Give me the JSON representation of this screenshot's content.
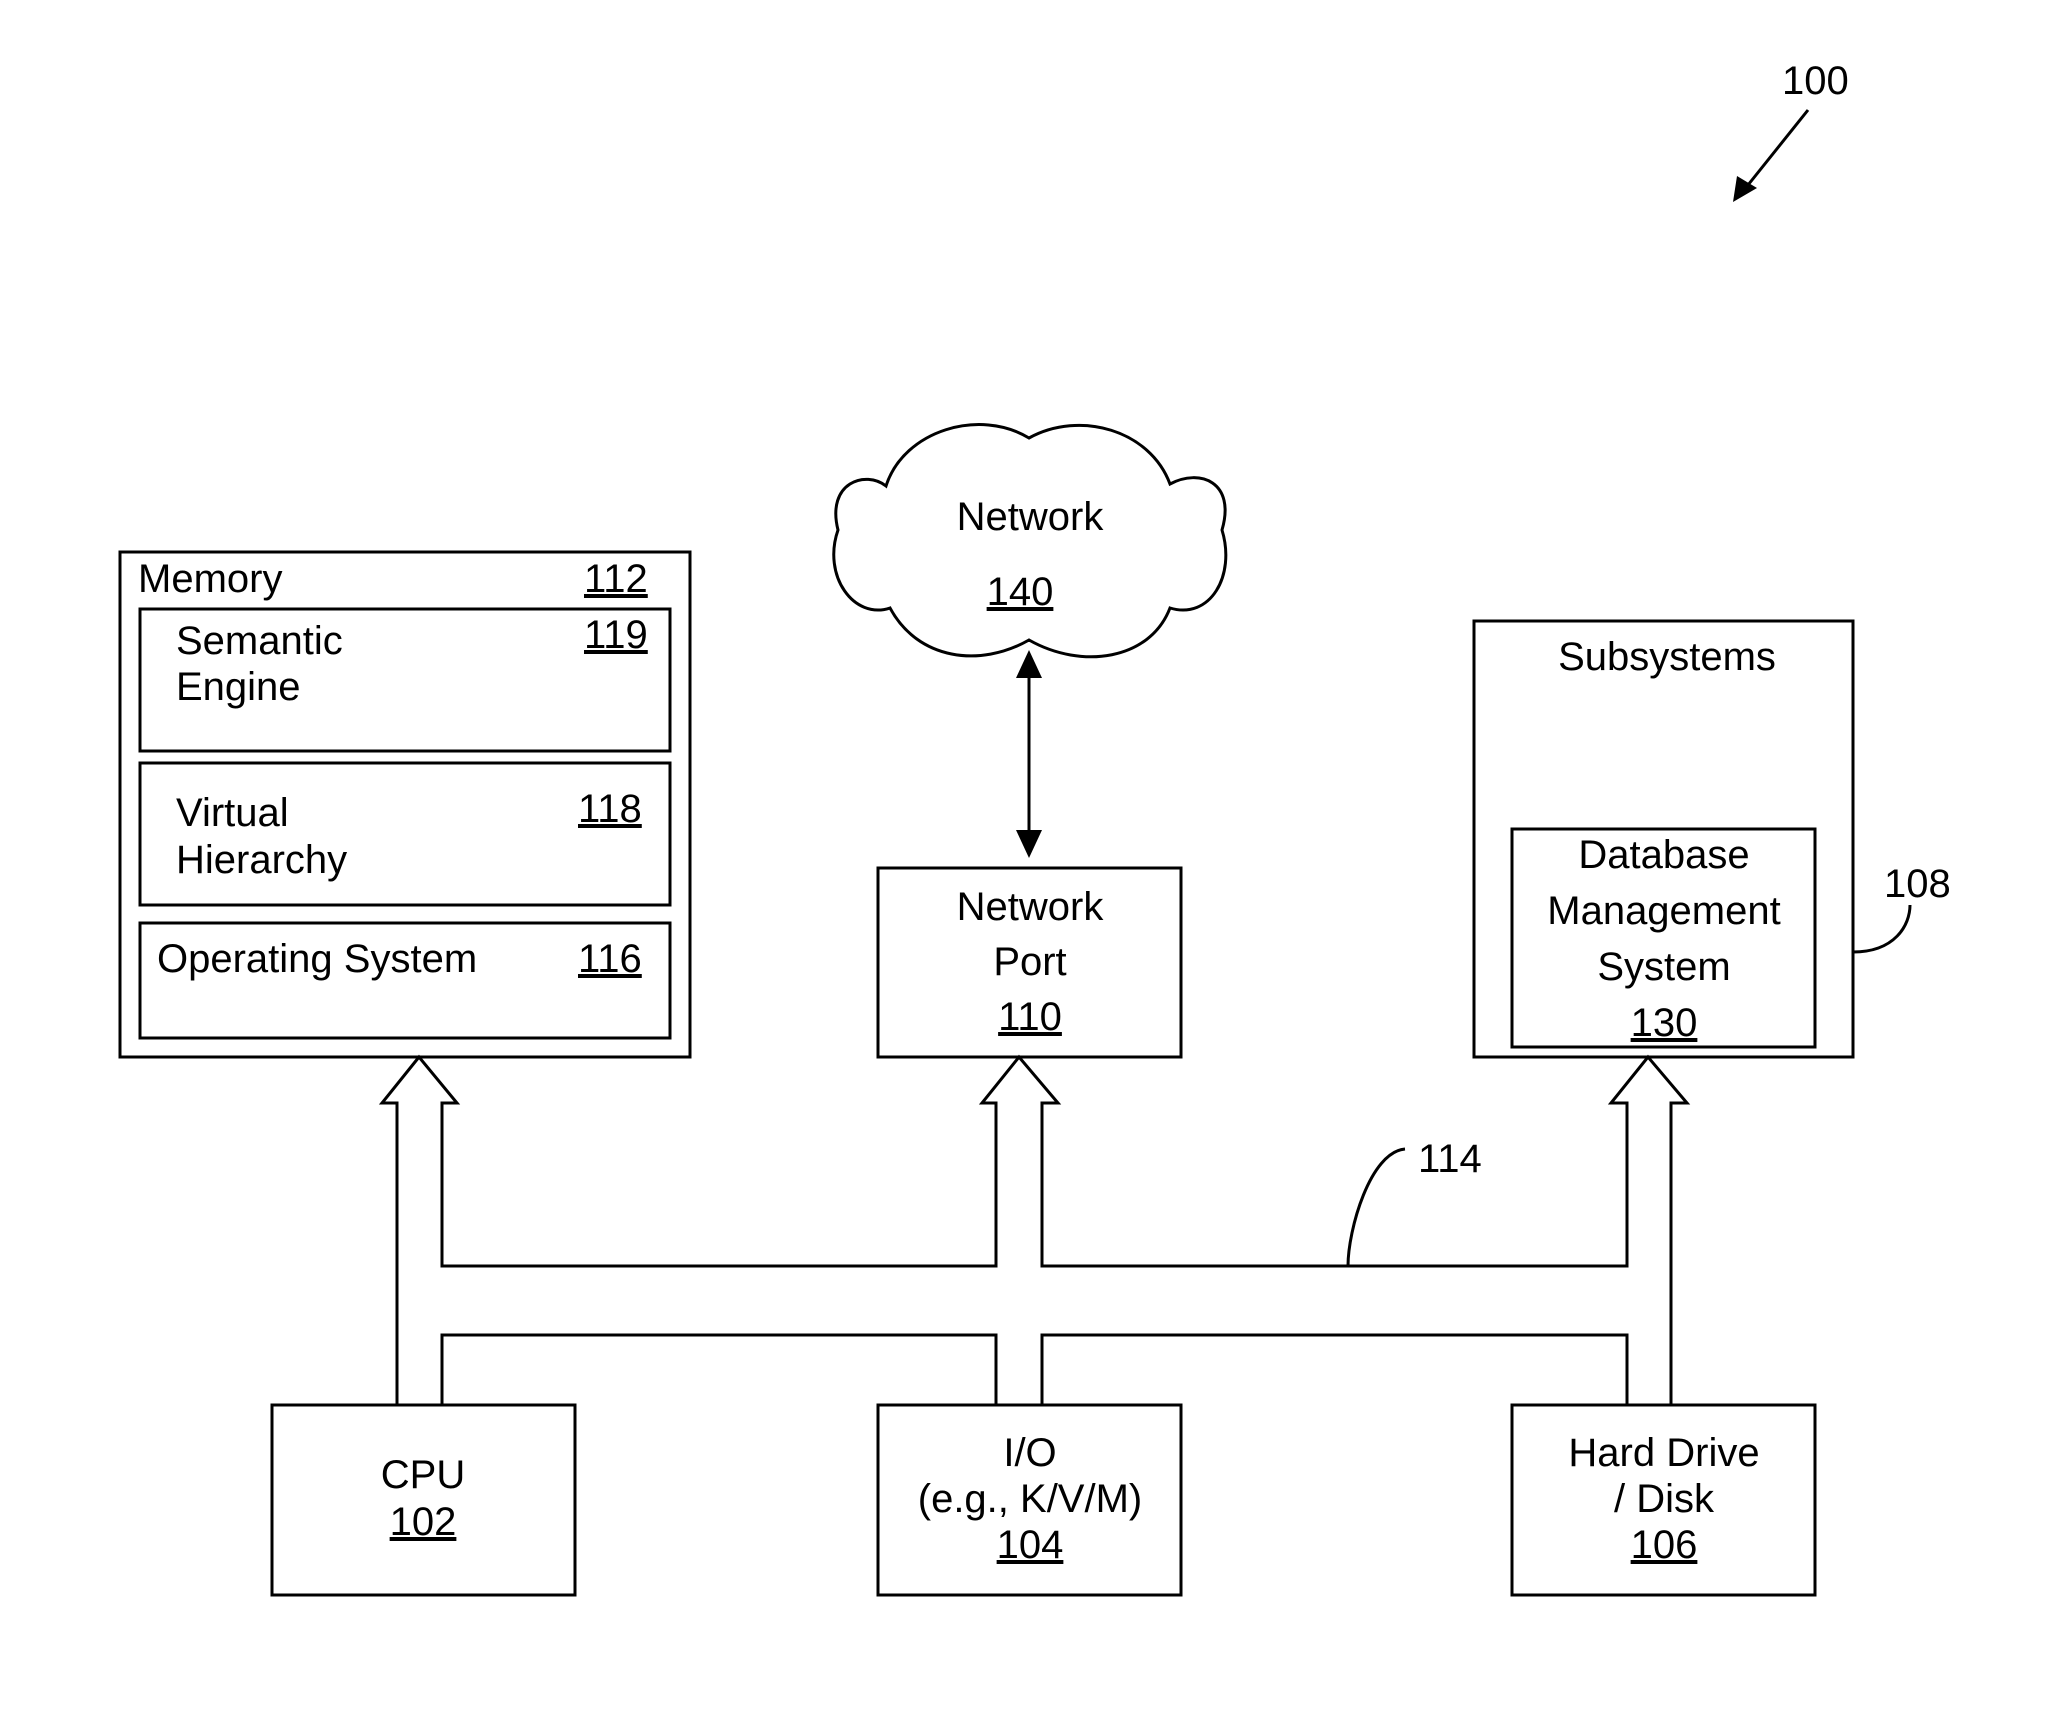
{
  "figure": {
    "ref": "100",
    "bus_ref": "114",
    "subsystems_ref": "108"
  },
  "memory": {
    "title": "Memory",
    "ref": "112",
    "items": [
      {
        "lines": [
          "Semantic",
          "Engine"
        ],
        "ref": "119"
      },
      {
        "lines": [
          "Virtual",
          "Hierarchy"
        ],
        "ref": "118"
      },
      {
        "lines": [
          "Operating System"
        ],
        "ref": "116"
      }
    ]
  },
  "network": {
    "title": "Network",
    "ref": "140"
  },
  "network_port": {
    "lines": [
      "Network",
      "Port"
    ],
    "ref": "110"
  },
  "subsystems": {
    "title": "Subsystems",
    "dbms": {
      "lines": [
        "Database",
        "Management",
        "System"
      ],
      "ref": "130"
    }
  },
  "cpu": {
    "lines": [
      "CPU"
    ],
    "ref": "102"
  },
  "io": {
    "lines": [
      "I/O",
      "(e.g., K/V/M)"
    ],
    "ref": "104"
  },
  "disk": {
    "lines": [
      "Hard Drive",
      "/ Disk"
    ],
    "ref": "106"
  }
}
